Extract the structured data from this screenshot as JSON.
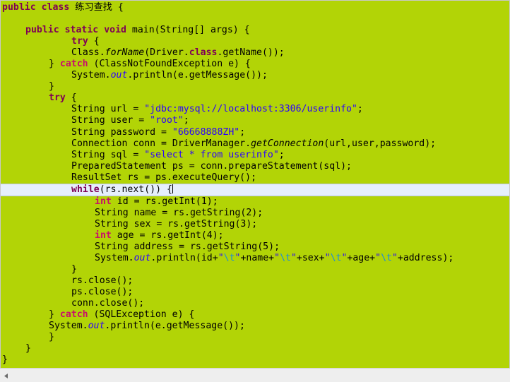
{
  "editor": {
    "background_color": "#b2d406",
    "current_line_highlight_color": "#e6effc",
    "keyword_color": "#7f0055",
    "keyword_alt_color": "#c7106a",
    "string_color": "#2a00ff",
    "escape_color": "#1d8ed6",
    "static_field_color": "#2a00ff",
    "language": "Java"
  },
  "code": {
    "lines": [
      {
        "id": 1,
        "indent": 0,
        "current": false,
        "tokens": [
          {
            "t": "public",
            "c": "kw"
          },
          {
            "t": " ",
            "c": "plain"
          },
          {
            "t": "class",
            "c": "kw"
          },
          {
            "t": " 练习查找 {",
            "c": "plain"
          }
        ],
        "text": "public class 练习查找 {"
      },
      {
        "id": 2,
        "indent": 0,
        "current": false,
        "tokens": [],
        "text": ""
      },
      {
        "id": 3,
        "indent": 33,
        "current": false,
        "tokens": [
          {
            "t": "public",
            "c": "kw"
          },
          {
            "t": " ",
            "c": "plain"
          },
          {
            "t": "static",
            "c": "kw"
          },
          {
            "t": " ",
            "c": "plain"
          },
          {
            "t": "void",
            "c": "kw"
          },
          {
            "t": " main(String[] args) {",
            "c": "plain"
          }
        ],
        "text": "public static void main(String[] args) {"
      },
      {
        "id": 4,
        "indent": 98,
        "current": false,
        "tokens": [
          {
            "t": "try",
            "c": "kw"
          },
          {
            "t": " {",
            "c": "plain"
          }
        ],
        "text": "try {"
      },
      {
        "id": 5,
        "indent": 98,
        "current": false,
        "tokens": [
          {
            "t": "Class.",
            "c": "plain"
          },
          {
            "t": "forName",
            "c": "stat"
          },
          {
            "t": "(Driver.",
            "c": "plain"
          },
          {
            "t": "class",
            "c": "kw"
          },
          {
            "t": ".getName());",
            "c": "plain"
          }
        ],
        "text": "Class.forName(Driver.class.getName());"
      },
      {
        "id": 6,
        "indent": 66,
        "current": false,
        "tokens": [
          {
            "t": "} ",
            "c": "plain"
          },
          {
            "t": "catch",
            "c": "kw2"
          },
          {
            "t": " (ClassNotFoundException e) {",
            "c": "plain"
          }
        ],
        "text": "} catch (ClassNotFoundException e) {"
      },
      {
        "id": 7,
        "indent": 98,
        "current": false,
        "tokens": [
          {
            "t": "System.",
            "c": "plain"
          },
          {
            "t": "out",
            "c": "stat-b"
          },
          {
            "t": ".println(e.getMessage());",
            "c": "plain"
          }
        ],
        "text": "System.out.println(e.getMessage());"
      },
      {
        "id": 8,
        "indent": 66,
        "current": false,
        "tokens": [
          {
            "t": "}",
            "c": "plain"
          }
        ],
        "text": "}"
      },
      {
        "id": 9,
        "indent": 66,
        "current": false,
        "tokens": [
          {
            "t": "try",
            "c": "kw"
          },
          {
            "t": " {",
            "c": "plain"
          }
        ],
        "text": "try {"
      },
      {
        "id": 10,
        "indent": 98,
        "current": false,
        "tokens": [
          {
            "t": "String url = ",
            "c": "plain"
          },
          {
            "t": "\"jdbc:mysql://localhost:3306/userinfo\"",
            "c": "str"
          },
          {
            "t": ";",
            "c": "plain"
          }
        ],
        "text": "String url = \"jdbc:mysql://localhost:3306/userinfo\";"
      },
      {
        "id": 11,
        "indent": 98,
        "current": false,
        "tokens": [
          {
            "t": "String user = ",
            "c": "plain"
          },
          {
            "t": "\"root\"",
            "c": "str"
          },
          {
            "t": ";",
            "c": "plain"
          }
        ],
        "text": "String user = \"root\";"
      },
      {
        "id": 12,
        "indent": 98,
        "current": false,
        "tokens": [
          {
            "t": "String password = ",
            "c": "plain"
          },
          {
            "t": "\"66668888ZH\"",
            "c": "str"
          },
          {
            "t": ";",
            "c": "plain"
          }
        ],
        "text": "String password = \"66668888ZH\";"
      },
      {
        "id": 13,
        "indent": 98,
        "current": false,
        "tokens": [
          {
            "t": "Connection conn = DriverManager.",
            "c": "plain"
          },
          {
            "t": "getConnection",
            "c": "stat"
          },
          {
            "t": "(url,user,password);",
            "c": "plain"
          }
        ],
        "text": "Connection conn = DriverManager.getConnection(url,user,password);"
      },
      {
        "id": 14,
        "indent": 98,
        "current": false,
        "tokens": [
          {
            "t": "String sql = ",
            "c": "plain"
          },
          {
            "t": "\"select * from userinfo\"",
            "c": "str"
          },
          {
            "t": ";",
            "c": "plain"
          }
        ],
        "text": "String sql = \"select * from userinfo\";"
      },
      {
        "id": 15,
        "indent": 98,
        "current": false,
        "tokens": [
          {
            "t": "PreparedStatement ps = conn.prepareStatement(sql);",
            "c": "plain"
          }
        ],
        "text": "PreparedStatement ps = conn.prepareStatement(sql);"
      },
      {
        "id": 16,
        "indent": 98,
        "current": false,
        "tokens": [
          {
            "t": "ResultSet rs = ps.executeQuery();",
            "c": "plain"
          }
        ],
        "text": "ResultSet rs = ps.executeQuery();"
      },
      {
        "id": 17,
        "indent": 98,
        "current": true,
        "tokens": [
          {
            "t": "while",
            "c": "kw"
          },
          {
            "t": "(rs.next()) {",
            "c": "plain"
          }
        ],
        "caret": true,
        "text": "while(rs.next()) {"
      },
      {
        "id": 18,
        "indent": 131,
        "current": false,
        "tokens": [
          {
            "t": "int",
            "c": "kw2"
          },
          {
            "t": " id = rs.getInt(1);",
            "c": "plain"
          }
        ],
        "text": "int id = rs.getInt(1);"
      },
      {
        "id": 19,
        "indent": 131,
        "current": false,
        "tokens": [
          {
            "t": "String name = rs.getString(2);",
            "c": "plain"
          }
        ],
        "text": "String name = rs.getString(2);"
      },
      {
        "id": 20,
        "indent": 131,
        "current": false,
        "tokens": [
          {
            "t": "String sex = rs.getString(3);",
            "c": "plain"
          }
        ],
        "text": "String sex = rs.getString(3);"
      },
      {
        "id": 21,
        "indent": 131,
        "current": false,
        "tokens": [
          {
            "t": "int",
            "c": "kw2"
          },
          {
            "t": " age = rs.getInt(4);",
            "c": "plain"
          }
        ],
        "text": "int age = rs.getInt(4);"
      },
      {
        "id": 22,
        "indent": 131,
        "current": false,
        "tokens": [
          {
            "t": "String address = rs.getString(5);",
            "c": "plain"
          }
        ],
        "text": "String address = rs.getString(5);"
      },
      {
        "id": 23,
        "indent": 131,
        "current": false,
        "tokens": [
          {
            "t": "System.",
            "c": "plain"
          },
          {
            "t": "out",
            "c": "stat-b"
          },
          {
            "t": ".println(id+",
            "c": "plain"
          },
          {
            "t": "\"",
            "c": "str"
          },
          {
            "t": "\\t",
            "c": "esc"
          },
          {
            "t": "\"",
            "c": "str"
          },
          {
            "t": "+name+",
            "c": "plain"
          },
          {
            "t": "\"",
            "c": "str"
          },
          {
            "t": "\\t",
            "c": "esc"
          },
          {
            "t": "\"",
            "c": "str"
          },
          {
            "t": "+sex+",
            "c": "plain"
          },
          {
            "t": "\"",
            "c": "str"
          },
          {
            "t": "\\t",
            "c": "esc"
          },
          {
            "t": "\"",
            "c": "str"
          },
          {
            "t": "+age+",
            "c": "plain"
          },
          {
            "t": "\"",
            "c": "str"
          },
          {
            "t": "\\t",
            "c": "esc"
          },
          {
            "t": "\"",
            "c": "str"
          },
          {
            "t": "+address);",
            "c": "plain"
          }
        ],
        "text": "System.out.println(id+\"\\t\"+name+\"\\t\"+sex+\"\\t\"+age+\"\\t\"+address);"
      },
      {
        "id": 24,
        "indent": 98,
        "current": false,
        "tokens": [
          {
            "t": "}",
            "c": "plain"
          }
        ],
        "text": "}"
      },
      {
        "id": 25,
        "indent": 98,
        "current": false,
        "tokens": [
          {
            "t": "rs.close();",
            "c": "plain"
          }
        ],
        "text": "rs.close();"
      },
      {
        "id": 26,
        "indent": 98,
        "current": false,
        "tokens": [
          {
            "t": "ps.close();",
            "c": "plain"
          }
        ],
        "text": "ps.close();"
      },
      {
        "id": 27,
        "indent": 98,
        "current": false,
        "tokens": [
          {
            "t": "conn.close();",
            "c": "plain"
          }
        ],
        "text": "conn.close();"
      },
      {
        "id": 28,
        "indent": 66,
        "current": false,
        "tokens": [
          {
            "t": "} ",
            "c": "plain"
          },
          {
            "t": "catch",
            "c": "kw2"
          },
          {
            "t": " (SQLException e) {",
            "c": "plain"
          }
        ],
        "text": "} catch (SQLException e) {"
      },
      {
        "id": 29,
        "indent": 66,
        "current": false,
        "tokens": [
          {
            "t": "System.",
            "c": "plain"
          },
          {
            "t": "out",
            "c": "stat-b"
          },
          {
            "t": ".println(e.getMessage());",
            "c": "plain"
          }
        ],
        "text": "System.out.println(e.getMessage());"
      },
      {
        "id": 30,
        "indent": 66,
        "current": false,
        "tokens": [
          {
            "t": "}",
            "c": "plain"
          }
        ],
        "text": "}"
      },
      {
        "id": 31,
        "indent": 33,
        "current": false,
        "tokens": [
          {
            "t": "}",
            "c": "plain"
          }
        ],
        "text": "}"
      },
      {
        "id": 32,
        "indent": 0,
        "current": false,
        "tokens": [
          {
            "t": "}",
            "c": "plain"
          }
        ],
        "text": "}"
      }
    ]
  },
  "scrollbar": {
    "orientation": "horizontal",
    "left_arrow_icon": "chevron-left-icon"
  }
}
